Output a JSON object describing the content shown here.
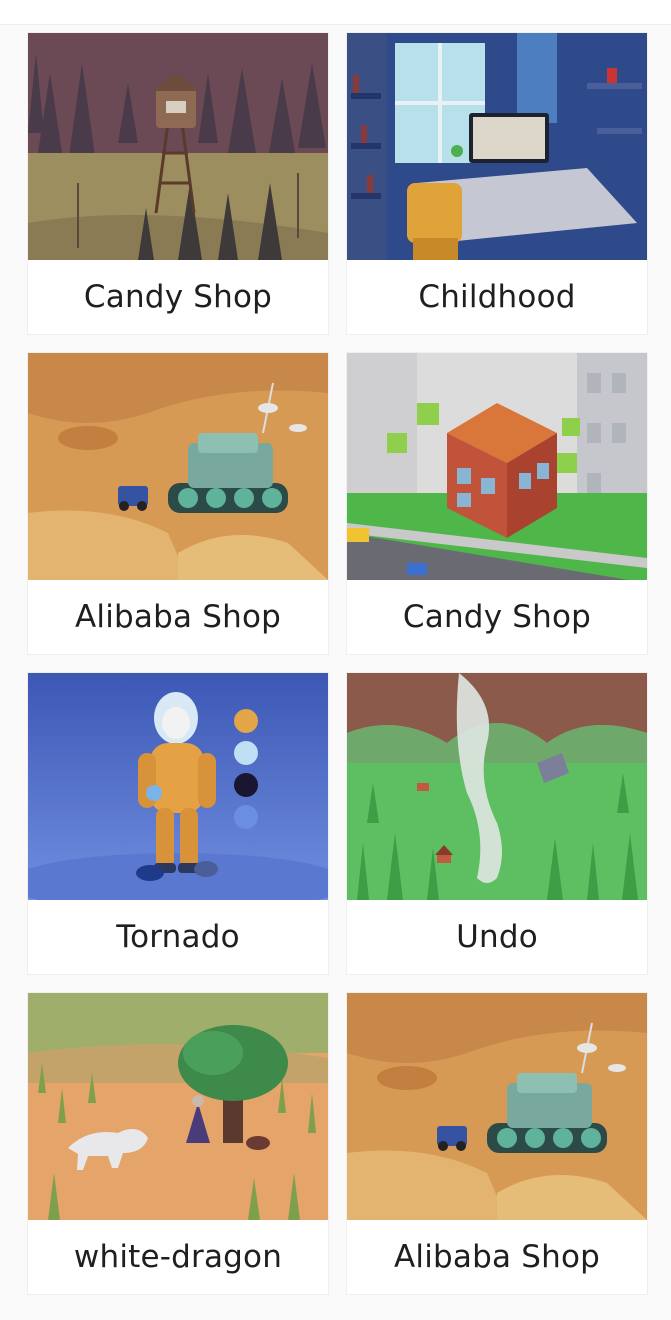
{
  "gallery": {
    "cards": [
      {
        "title": "Candy Shop",
        "scene": "water-tower-forest-icon"
      },
      {
        "title": "Childhood",
        "scene": "desk-room-icon"
      },
      {
        "title": "Alibaba Shop",
        "scene": "desert-tank-icon"
      },
      {
        "title": "Candy Shop",
        "scene": "town-house-icon"
      },
      {
        "title": "Tornado",
        "scene": "astronaut-icon"
      },
      {
        "title": "Undo",
        "scene": "tornado-field-icon"
      },
      {
        "title": "white-dragon",
        "scene": "dragon-tree-icon"
      },
      {
        "title": "Alibaba Shop",
        "scene": "desert-tank-icon"
      }
    ]
  },
  "colors": {
    "card_bg": "#ffffff",
    "caption_text": "#1f1f1f",
    "page_bg": "#fafafa"
  }
}
